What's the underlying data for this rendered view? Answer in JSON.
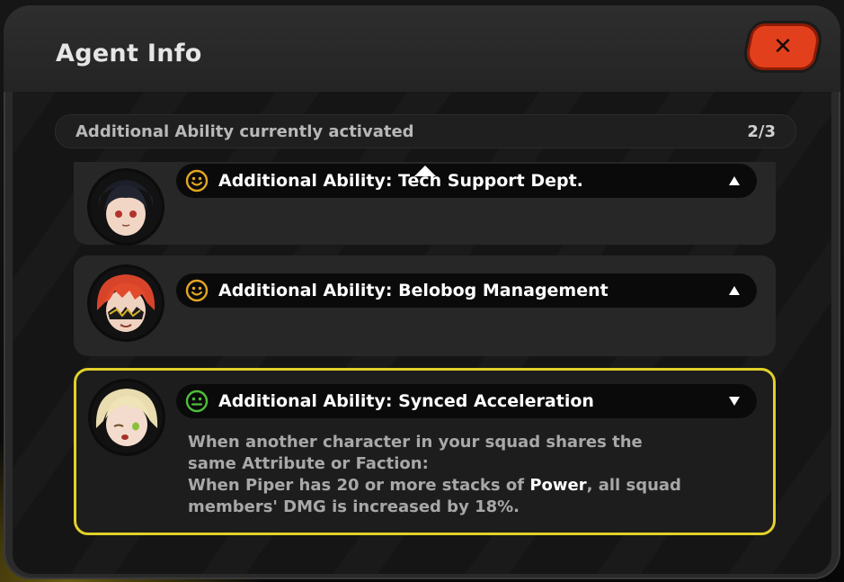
{
  "dialog": {
    "title": "Agent Info"
  },
  "status": {
    "label": "Additional Ability currently activated",
    "count": "2/3"
  },
  "abilities": [
    {
      "name": "Additional Ability: Tech Support Dept.",
      "icon": "smile-icon",
      "icon_color": "#e3a622",
      "expanded": false,
      "caret": "up"
    },
    {
      "name": "Additional Ability: Belobog Management",
      "icon": "smile-icon",
      "icon_color": "#e3a622",
      "expanded": false,
      "caret": "up"
    },
    {
      "name": "Additional Ability: Synced Acceleration",
      "icon": "neutral-face-icon",
      "icon_color": "#4fbf3a",
      "expanded": true,
      "caret": "down",
      "desc_line1": "When another character in your squad shares the",
      "desc_line2": "same Attribute or Faction:",
      "desc_line3_pre": "When Piper has 20 or more stacks of ",
      "desc_line3_bold": "Power",
      "desc_line3_post": ", all squad",
      "desc_line4": "members' DMG is increased by 18%."
    }
  ],
  "colors": {
    "accent_yellow": "#e2d12a",
    "close_red": "#e2401c",
    "inactive_icon_orange": "#e3a622",
    "active_icon_green": "#4fbf3a"
  }
}
